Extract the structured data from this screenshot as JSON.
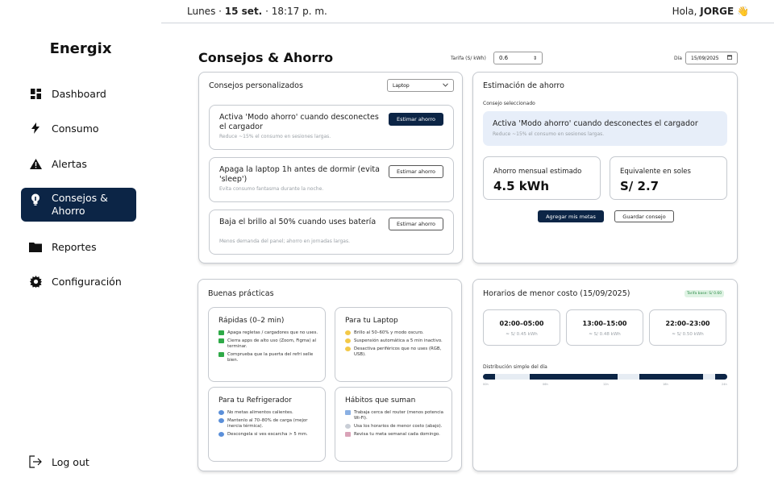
{
  "sidebar": {
    "brand": "Energix",
    "items": [
      {
        "label": "Dashboard",
        "icon": "dashboard-icon"
      },
      {
        "label": "Consumo",
        "icon": "bolt-icon"
      },
      {
        "label": "Alertas",
        "icon": "warning-icon"
      },
      {
        "label": "Consejos & Ahorro",
        "icon": "lightbulb-icon",
        "active": true
      },
      {
        "label": "Reportes",
        "icon": "folder-icon"
      },
      {
        "label": "Configuración",
        "icon": "gear-icon"
      }
    ],
    "logout": "Log out"
  },
  "topbar": {
    "day": "Lunes ·",
    "date": "15 set.",
    "time": "· 18:17 p. m.",
    "greeting": "Hola,",
    "user": "JORGE",
    "wave": "👋"
  },
  "header": {
    "title": "Consejos & Ahorro",
    "tarifa_label": "Tarifa (S/ kWh)",
    "tarifa_value": "0.6",
    "dia_label": "Día",
    "dia_value": "15/09/2025"
  },
  "consejos": {
    "title": "Consejos personalizados",
    "device": "Laptop",
    "tips": [
      {
        "title": "Activa 'Modo ahorro' cuando desconectes el cargador",
        "sub": "Reduce ~15% el consumo en sesiones largas.",
        "button": "Estimar ahorro",
        "primary": true
      },
      {
        "title": "Apaga la laptop 1h antes de dormir (evita 'sleep')",
        "sub": "Evita consumo fantasma durante la noche.",
        "button": "Estimar ahorro",
        "primary": false
      },
      {
        "title": "Baja el brillo al 50% cuando uses batería",
        "sub": "Menos demanda del panel; ahorro en jornadas largas.",
        "button": "Estimar ahorro",
        "primary": false
      }
    ]
  },
  "estimacion": {
    "title": "Estimación de ahorro",
    "selected_label": "Consejo seleccionado",
    "selected_title": "Activa 'Modo ahorro' cuando desconectes el cargador",
    "selected_sub": "Reduce ~15% el consumo en sesiones largas.",
    "monthly_label": "Ahorro mensual estimado",
    "monthly_value": "4.5 kWh",
    "soles_label": "Equivalente en soles",
    "soles_value": "S/ 2.7",
    "add_button": "Agregar mis metas",
    "save_button": "Guardar consejo"
  },
  "practicas": {
    "title": "Buenas prácticas",
    "groups": [
      {
        "title": "Rápidas (0–2 min)",
        "bullet": "check",
        "items": [
          "Apaga regletas / cargadores que no uses.",
          "Cierra apps de alto uso (Zoom, Figma) al terminar.",
          "Comprueba que la puerta del refri selle bien."
        ]
      },
      {
        "title": "Para tu Laptop",
        "bullet": "bulb",
        "items": [
          "Brillo al 50–60% y modo oscuro.",
          "Suspensión automática a 5 min inactivo.",
          "Desactiva periféricos que no uses (RGB, USB)."
        ]
      },
      {
        "title": "Para tu Refrigerador",
        "bullet": "blue",
        "items": [
          "No metas alimentos calientes.",
          "Mantenlo al 70–80% de carga (mejor inercia térmica).",
          "Descongela si ves escarcha > 5 mm."
        ]
      },
      {
        "title": "Hábitos que suman",
        "bullet": "sq",
        "items": [
          "Trabaja cerca del router (menos potencia Wi-Fi).",
          "Usa los horarios de menor costo (abajo).",
          "Revisa tu meta semanal cada domingo."
        ]
      }
    ]
  },
  "horarios": {
    "title": "Horarios de menor costo (15/09/2025)",
    "badge": "Tarifa base: S/ 0.60",
    "slots": [
      {
        "range": "02:00–05:00",
        "price": "≈ S/ 0.45 kWh"
      },
      {
        "range": "13:00–15:00",
        "price": "≈ S/ 0.48 kWh"
      },
      {
        "range": "22:00–23:00",
        "price": "≈ S/ 0.50 kWh"
      }
    ],
    "dist_label": "Distribución simple del día",
    "ticks": [
      "00h",
      "06h",
      "12h",
      "18h",
      "24h"
    ],
    "low_cost_segments": [
      [
        0,
        0.05
      ],
      [
        0.19,
        0.55
      ],
      [
        0.64,
        0.9
      ],
      [
        0.95,
        1.0
      ]
    ]
  },
  "colors": {
    "accent": "#0c2546",
    "highlight": "#e7eef9",
    "badge": "#dff3e4"
  }
}
